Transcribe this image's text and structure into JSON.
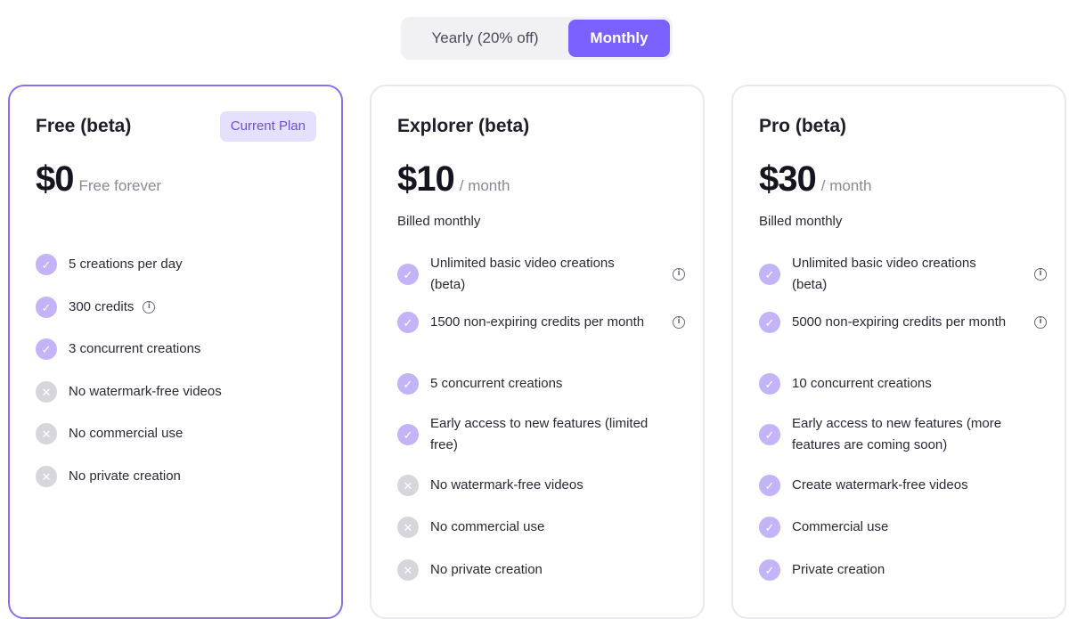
{
  "toggle": {
    "yearly_label": "Yearly (20% off)",
    "monthly_label": "Monthly",
    "selected": "monthly"
  },
  "plans": [
    {
      "name": "Free (beta)",
      "badge": "Current Plan",
      "price": "$0",
      "price_suffix": "Free forever",
      "billed": "",
      "features": [
        {
          "text": "5 creations per day",
          "included": true,
          "info": false
        },
        {
          "text": "300 credits",
          "included": true,
          "info": true
        },
        {
          "text": "3 concurrent creations",
          "included": true,
          "info": false
        },
        {
          "text": "No watermark-free videos",
          "included": false,
          "info": false
        },
        {
          "text": "No commercial use",
          "included": false,
          "info": false
        },
        {
          "text": "No private creation",
          "included": false,
          "info": false
        }
      ]
    },
    {
      "name": "Explorer (beta)",
      "badge": "",
      "price": "$10",
      "price_suffix": "/ month",
      "billed": "Billed monthly",
      "features": [
        {
          "text": "Unlimited basic video creations (beta)",
          "included": true,
          "info": true
        },
        {
          "text": "1500 non-expiring credits per month",
          "included": true,
          "info": true
        },
        {
          "text": "5 concurrent creations",
          "included": true,
          "info": false
        },
        {
          "text": "Early access to new features (limited free)",
          "included": true,
          "info": false
        },
        {
          "text": "No watermark-free videos",
          "included": false,
          "info": false
        },
        {
          "text": "No commercial use",
          "included": false,
          "info": false
        },
        {
          "text": "No private creation",
          "included": false,
          "info": false
        }
      ]
    },
    {
      "name": "Pro (beta)",
      "badge": "",
      "price": "$30",
      "price_suffix": "/ month",
      "billed": "Billed monthly",
      "features": [
        {
          "text": "Unlimited basic video creations (beta)",
          "included": true,
          "info": true
        },
        {
          "text": "5000 non-expiring credits per month",
          "included": true,
          "info": true
        },
        {
          "text": "10 concurrent creations",
          "included": true,
          "info": false
        },
        {
          "text": "Early access to new features (more features are coming soon)",
          "included": true,
          "info": false
        },
        {
          "text": "Create watermark-free videos",
          "included": true,
          "info": false
        },
        {
          "text": "Commercial use",
          "included": true,
          "info": false
        },
        {
          "text": "Private creation",
          "included": true,
          "info": false
        }
      ]
    }
  ],
  "icons": {
    "check": "check-icon",
    "cross": "cross-icon",
    "info": "info-icon"
  },
  "colors": {
    "accent": "#7b61ff",
    "current_border": "#8b6fe8",
    "check_bg": "#c3b4f8",
    "cross_bg": "#d6d6dc",
    "badge_bg": "#e6e0ff"
  }
}
